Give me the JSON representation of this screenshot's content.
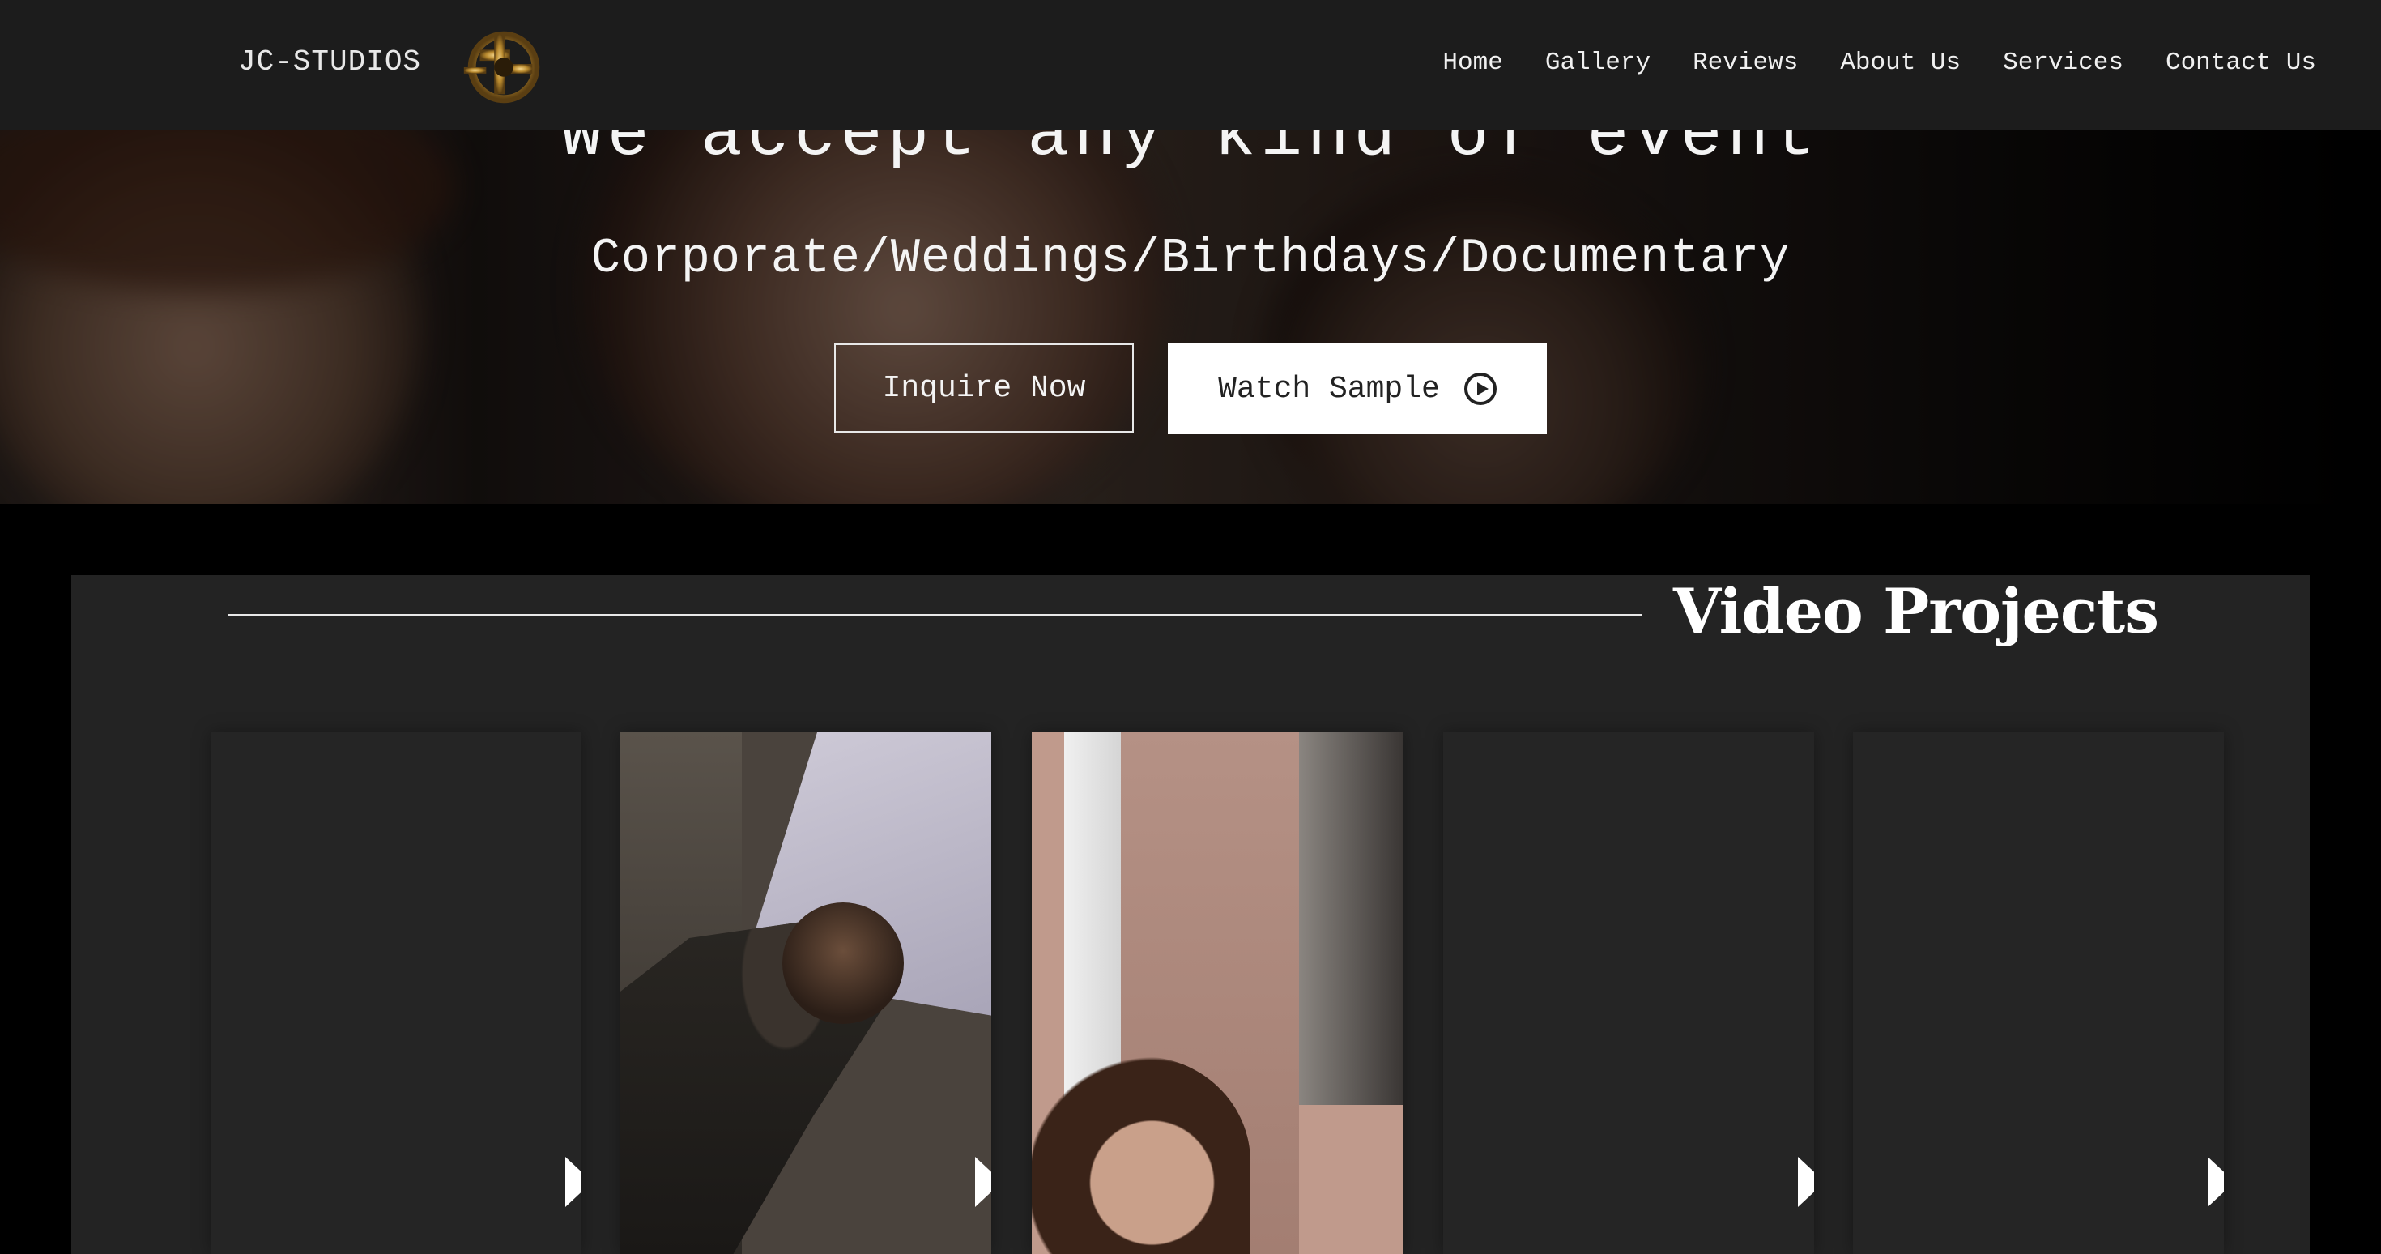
{
  "header": {
    "brand": "JC-STUDIOS",
    "logo_icon": "jc-studios-gold-logo",
    "nav": [
      {
        "label": "Home"
      },
      {
        "label": "Gallery"
      },
      {
        "label": "Reviews"
      },
      {
        "label": "About Us"
      },
      {
        "label": "Services"
      },
      {
        "label": "Contact Us"
      }
    ]
  },
  "hero": {
    "title": "We accept any kind of event",
    "subtitle": "Corporate/Weddings/Birthdays/Documentary",
    "inquire_label": "Inquire Now",
    "watch_label": "Watch Sample",
    "watch_icon": "play-circle-icon"
  },
  "projects": {
    "title": "Video Projects",
    "cards": [
      {
        "thumbnail": "empty"
      },
      {
        "thumbnail": "man-leaning"
      },
      {
        "thumbnail": "woman-smiling"
      },
      {
        "thumbnail": "empty"
      },
      {
        "thumbnail": "empty"
      }
    ]
  },
  "colors": {
    "topbar": "#1c1c1c",
    "section": "#232323",
    "card": "#252525",
    "button_bg": "#ffffff"
  }
}
